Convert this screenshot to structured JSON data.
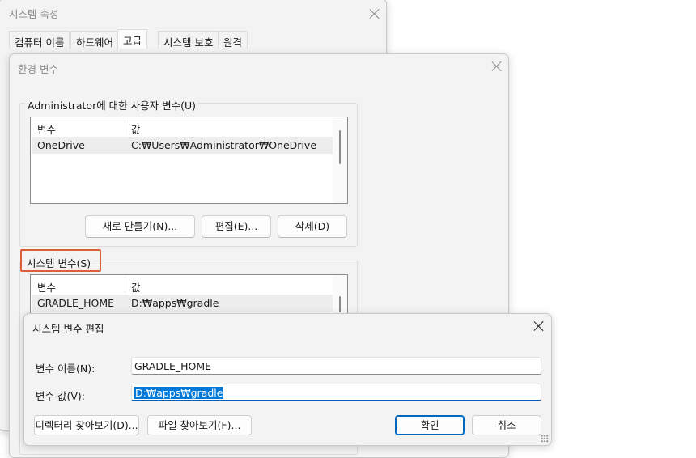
{
  "system_properties": {
    "title": "시스템 속성",
    "tabs": [
      "컴퓨터 이름",
      "하드웨어",
      "고급",
      "시스템 보호",
      "원격"
    ],
    "active_tab": "고급"
  },
  "env_vars": {
    "title": "환경 변수",
    "user_group_label": "Administrator에 대한 사용자 변수(U)",
    "user_table": {
      "columns": [
        "변수",
        "값"
      ],
      "rows": [
        {
          "name": "OneDrive",
          "value": "C:₩Users₩Administrator₩OneDrive"
        }
      ]
    },
    "buttons": {
      "new": "새로 만들기(N)...",
      "edit": "편집(E)...",
      "delete": "삭제(D)"
    },
    "system_group_label": "시스템 변수(S)",
    "system_table": {
      "columns": [
        "변수",
        "값"
      ],
      "rows": [
        {
          "name": "GRADLE_HOME",
          "value": "D:₩apps₩gradle"
        }
      ]
    }
  },
  "edit_dialog": {
    "title": "시스템 변수 편집",
    "name_label": "변수 이름(N):",
    "name_value": "GRADLE_HOME",
    "value_label": "변수 값(V):",
    "value_value": "D:₩apps₩gradle",
    "browse_dir": "디렉터리 찾아보기(D)...",
    "browse_file": "파일 찾아보기(F)...",
    "ok": "확인",
    "cancel": "취소"
  },
  "colors": {
    "accent": "#0067c0",
    "highlight_box": "#d9603b",
    "selection": "#0078d7"
  }
}
